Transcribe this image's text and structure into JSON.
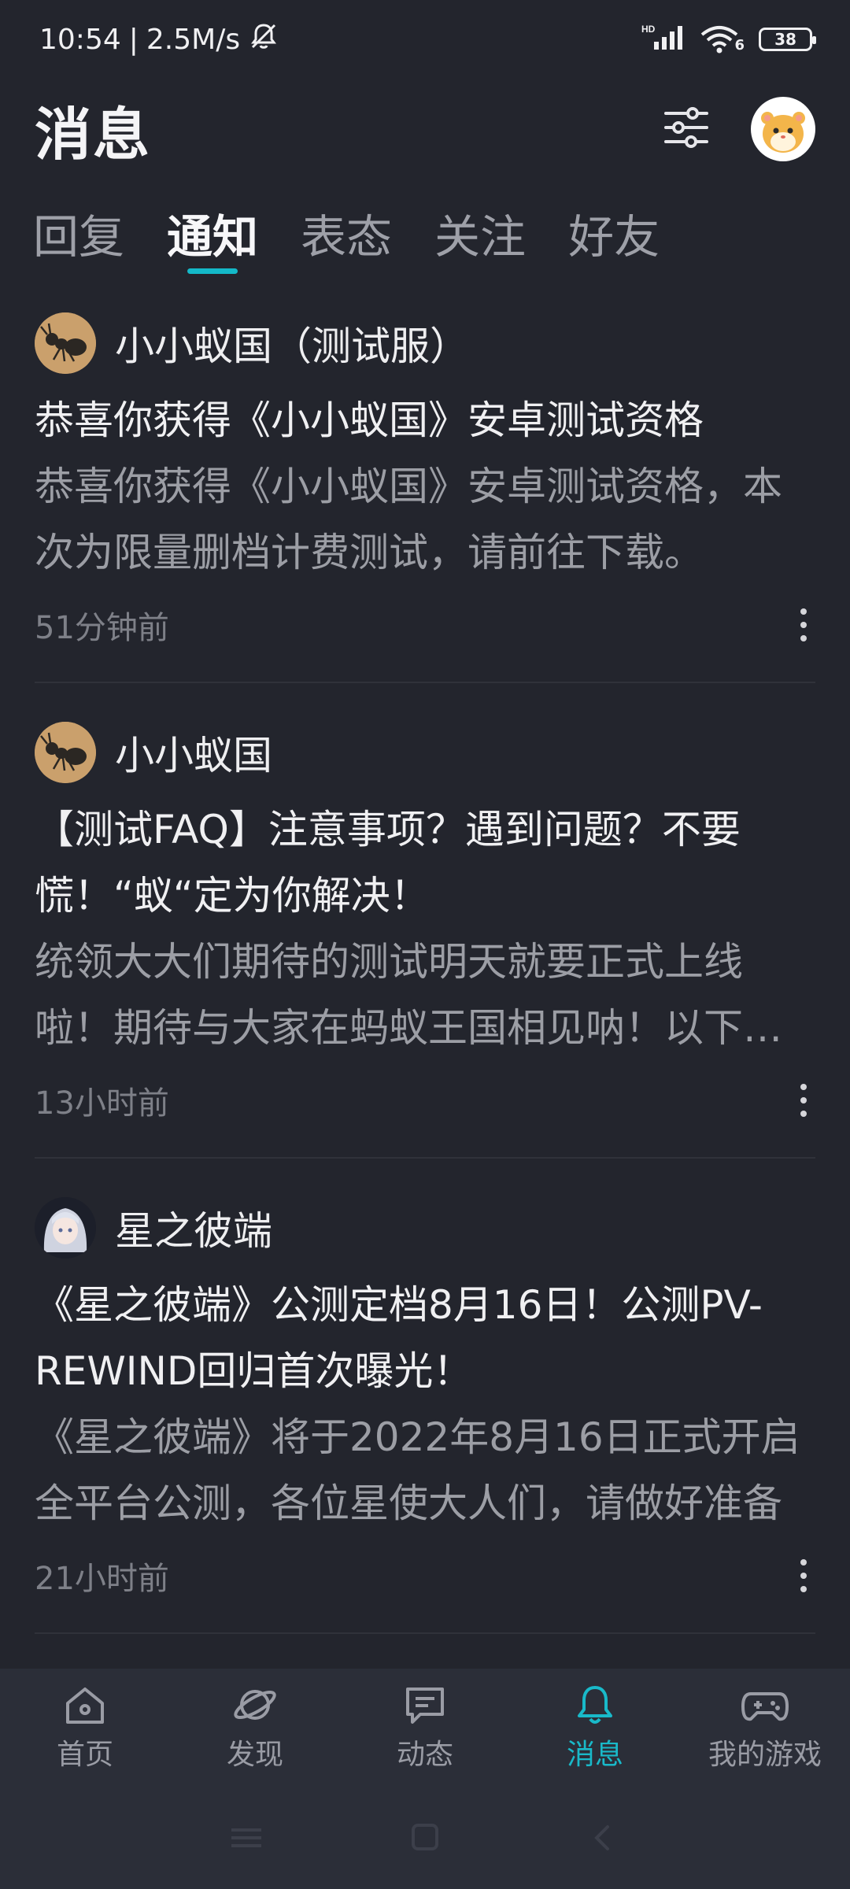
{
  "status_bar": {
    "time": "10:54",
    "speed": "2.5M/s",
    "network": "HD",
    "wifi_level": "6",
    "battery": "38"
  },
  "header": {
    "title": "消息",
    "filter_icon": "sliders-icon",
    "avatar_icon": "hamster-avatar"
  },
  "tabs": [
    {
      "label": "回复",
      "active": false
    },
    {
      "label": "通知",
      "active": true
    },
    {
      "label": "表态",
      "active": false
    },
    {
      "label": "关注",
      "active": false
    },
    {
      "label": "好友",
      "active": false
    }
  ],
  "notifications": [
    {
      "source": "小小蚁国（测试服）",
      "title": "恭喜你获得《小小蚁国》安卓测试资格",
      "body": "恭喜你获得《小小蚁国》安卓测试资格，本次为限量删档计费测试，请前往下载。",
      "time": "51分钟前",
      "avatar": "ant-icon"
    },
    {
      "source": "小小蚁国",
      "title": "【测试FAQ】注意事项？遇到问题？不要慌！“蚁“定为你解决！",
      "body": "统领大大们期待的测试明天就要正式上线啦！期待与大家在蚂蚁王国相见呐！以下为测试相关注意事项",
      "time": "13小时前",
      "avatar": "ant-icon"
    },
    {
      "source": "星之彼端",
      "title": "《星之彼端》公测定档8月16日！公测PV-REWIND回归首次曝光！",
      "body": "《星之彼端》将于2022年8月16日正式开启全平台公测，各位星使大人们，请做好准备",
      "time": "21小时前",
      "avatar": "anime-girl-icon"
    }
  ],
  "bottom_nav": [
    {
      "label": "首页",
      "icon": "home-icon",
      "active": false
    },
    {
      "label": "发现",
      "icon": "planet-icon",
      "active": false
    },
    {
      "label": "动态",
      "icon": "chat-icon",
      "active": false
    },
    {
      "label": "消息",
      "icon": "bell-icon",
      "active": true
    },
    {
      "label": "我的游戏",
      "icon": "gamepad-icon",
      "active": false
    }
  ],
  "colors": {
    "background": "#23252d",
    "accent": "#14b9c8",
    "nav_bg": "#2b2e38"
  }
}
